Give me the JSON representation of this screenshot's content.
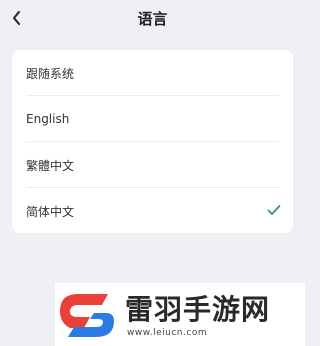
{
  "header": {
    "title": "语言",
    "back_icon": "chevron-left-icon"
  },
  "languages": [
    {
      "label": "跟随系统",
      "selected": false
    },
    {
      "label": "English",
      "selected": false
    },
    {
      "label": "繁體中文",
      "selected": false
    },
    {
      "label": "简体中文",
      "selected": true
    }
  ],
  "colors": {
    "background": "#eef0f3",
    "card": "#ffffff",
    "check": "#3a9a5a",
    "watermark_red": "#e8413a",
    "watermark_blue": "#2c7be5"
  },
  "watermark": {
    "name": "雷羽手游网",
    "url": "www.leiucn.com"
  }
}
